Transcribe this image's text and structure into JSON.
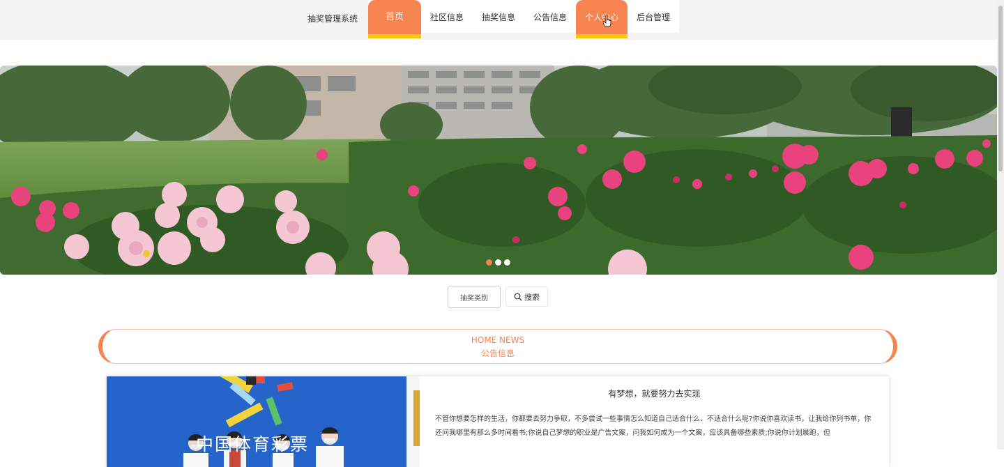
{
  "header": {
    "brand": "抽奖管理系统",
    "nav": [
      {
        "label": "首页",
        "active": true
      },
      {
        "label": "社区信息",
        "active": false
      },
      {
        "label": "抽奖信息",
        "active": false
      },
      {
        "label": "公告信息",
        "active": false
      },
      {
        "label": "个人中心",
        "active": true
      },
      {
        "label": "后台管理",
        "active": false
      }
    ]
  },
  "carousel": {
    "slide_count": 3,
    "current": 1
  },
  "search": {
    "category_label": "抽奖类别",
    "search_label": "搜索"
  },
  "section": {
    "title_en": "HOME NEWS",
    "title_cn": "公告信息"
  },
  "news": {
    "image_text": "中国体育彩票",
    "title": "有梦想，就要努力去实现",
    "body": "不管你想要怎样的生活，你都要去努力争取，不多尝试一些事情怎么知道自己适合什么、不适合什么呢?你说你喜欢读书，让我给你列书单，你还问我哪里有那么多时间看书;你说自己梦想的职业是广告文案，问我如何成为一个文案，应该具备哪些素质;你说你计划晨跑，但"
  },
  "colors": {
    "accent": "#f58450",
    "accent_underline": "#f7c810",
    "section_border": "#f3c1ad"
  }
}
